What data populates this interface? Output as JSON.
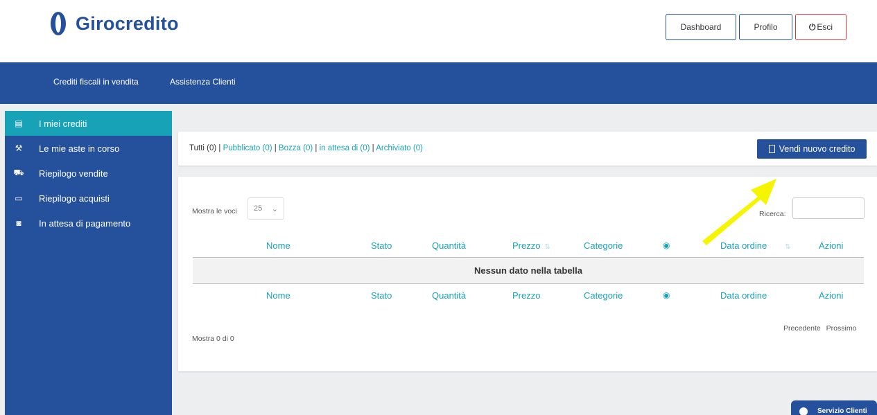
{
  "brand": {
    "name": "Girocredito"
  },
  "header": {
    "buttons": [
      {
        "label": "Dashboard"
      },
      {
        "label": "Profilo"
      },
      {
        "label": "Esci",
        "icon": "power-icon"
      }
    ]
  },
  "nav": {
    "items": [
      {
        "label": "Crediti fiscali in vendita"
      },
      {
        "label": "Assistenza Clienti"
      }
    ]
  },
  "sidebar": {
    "items": [
      {
        "label": "I miei crediti",
        "icon": "document-icon",
        "active": true
      },
      {
        "label": "Le mie aste in corso",
        "icon": "gavel-icon"
      },
      {
        "label": "Riepilogo vendite",
        "icon": "cart-icon"
      },
      {
        "label": "Riepilogo acquisti",
        "icon": "credit-card-icon"
      },
      {
        "label": "In attesa di pagamento",
        "icon": "money-icon"
      }
    ]
  },
  "filters": {
    "all": "Tutti (0)",
    "sep": " | ",
    "links": [
      "Pubblicato (0)",
      "Bozza (0)",
      "in attesa di (0)",
      "Archiviato (0)"
    ]
  },
  "actions": {
    "sell_new": "Vendi nuovo credito"
  },
  "table": {
    "length_label": "Mostra le voci",
    "length_value": "25",
    "search_label": "Ricerca:",
    "columns": [
      "Nome",
      "Stato",
      "Quantità",
      "Prezzo",
      "Categorie",
      "",
      "Data ordine",
      "Azioni"
    ],
    "empty_message": "Nessun dato nella tabella",
    "info": "Mostra 0 di 0",
    "pager": {
      "prev": "Precedente",
      "next": "Prossimo"
    }
  },
  "chat": {
    "label": "Servizio Clienti"
  },
  "colors": {
    "primary": "#25509c",
    "accent": "#17a2b8",
    "arrow": "#f5f500"
  }
}
